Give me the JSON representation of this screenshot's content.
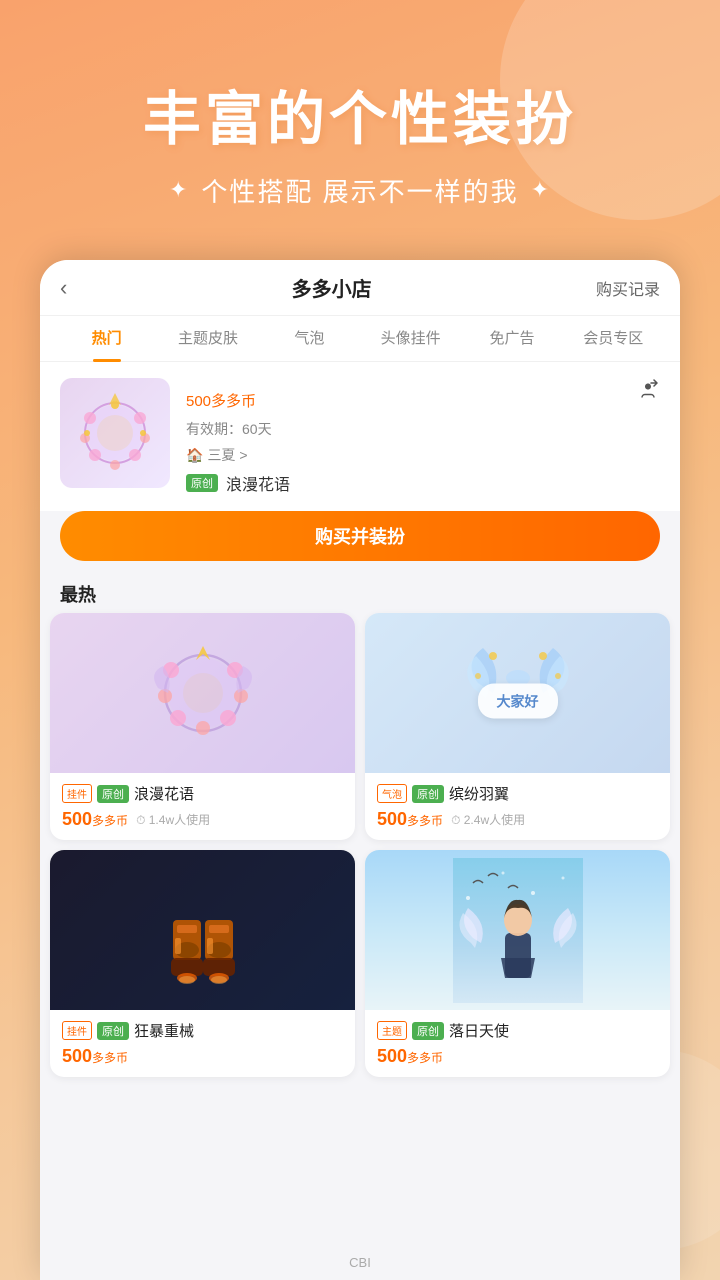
{
  "app": {
    "title": "CBI"
  },
  "background": {
    "main_title": "丰富的个性装扮",
    "sub_title": "个性搭配 展示不一样的我",
    "sparkle": "✦"
  },
  "shop": {
    "back_label": "‹",
    "title": "多多小店",
    "purchase_record": "购买记录",
    "tabs": [
      {
        "label": "热门",
        "active": true
      },
      {
        "label": "主题皮肤",
        "active": false
      },
      {
        "label": "气泡",
        "active": false
      },
      {
        "label": "头像挂件",
        "active": false
      },
      {
        "label": "免广告",
        "active": false
      },
      {
        "label": "会员专区",
        "active": false
      }
    ]
  },
  "featured": {
    "price": "500",
    "price_unit": "多多币",
    "validity_label": "有效期：60天",
    "author": "三夏 >",
    "tag_original": "原创",
    "name": "浪漫花语",
    "buy_button": "购买并装扮",
    "emoji": "🌸"
  },
  "most_popular": {
    "section_title": "最热",
    "items": [
      {
        "id": 1,
        "type_tag": "挂件",
        "original_tag": "原创",
        "name": "浪漫花语",
        "price": "500",
        "price_unit": "多多币",
        "users": "1.4w人使用",
        "image_type": "frame",
        "emoji": "🌸"
      },
      {
        "id": 2,
        "type_tag": "气泡",
        "original_tag": "原创",
        "name": "缤纷羽翼",
        "price": "500",
        "price_unit": "多多币",
        "users": "2.4w人使用",
        "image_type": "bubble_wings",
        "chat_text": "大家好",
        "emoji": "🦋"
      },
      {
        "id": 3,
        "type_tag": "挂件",
        "original_tag": "原创",
        "name": "狂暴重械",
        "price": "500",
        "price_unit": "多多币",
        "users": "",
        "image_type": "mech",
        "emoji": "🤖"
      },
      {
        "id": 4,
        "type_tag": "主题",
        "original_tag": "原创",
        "name": "落日天使",
        "price": "500",
        "price_unit": "多多币",
        "users": "",
        "image_type": "anime",
        "emoji": "👼"
      }
    ]
  },
  "bottom": {
    "label": "CBI"
  }
}
